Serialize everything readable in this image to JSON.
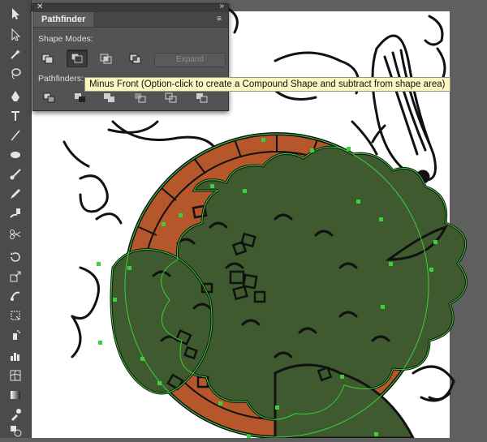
{
  "pathfinder_panel": {
    "title": "Pathfinder",
    "shape_modes_label": "Shape Modes:",
    "pathfinders_label": "Pathfinders:",
    "expand_label": "Expand",
    "shape_modes": [
      {
        "name": "unite",
        "icon": "unite-icon"
      },
      {
        "name": "minus-front",
        "icon": "minus-front-icon",
        "active": true
      },
      {
        "name": "intersect",
        "icon": "intersect-icon"
      },
      {
        "name": "exclude",
        "icon": "exclude-icon"
      }
    ],
    "pathfinders": [
      {
        "name": "divide",
        "icon": "divide-icon"
      },
      {
        "name": "trim",
        "icon": "trim-icon"
      },
      {
        "name": "merge",
        "icon": "merge-icon"
      },
      {
        "name": "crop",
        "icon": "crop-icon"
      },
      {
        "name": "outline",
        "icon": "outline-icon"
      },
      {
        "name": "minus-back",
        "icon": "minus-back-icon"
      }
    ]
  },
  "tooltip": {
    "text": "Minus Front (Option-click to create a Compound Shape and subtract from shape area)"
  },
  "toolbar": {
    "tools": [
      "selection-tool",
      "direct-selection-tool",
      "magic-wand-tool",
      "lasso-tool",
      "pen-tool",
      "type-tool",
      "line-tool",
      "ellipse-tool",
      "paintbrush-tool",
      "pencil-tool",
      "blob-brush-tool",
      "scissors-tool",
      "rotate-tool",
      "scale-tool",
      "warp-tool",
      "free-transform-tool",
      "symbol-sprayer-tool",
      "graph-tool",
      "mesh-tool",
      "gradient-tool",
      "eyedropper-tool",
      "blend-tool"
    ]
  },
  "colors": {
    "selection": "#3ad13a",
    "plate_fill": "#b5562b",
    "foliage_fill": "#3e5a2e",
    "stroke": "#111111",
    "ui_panel": "#535353"
  }
}
